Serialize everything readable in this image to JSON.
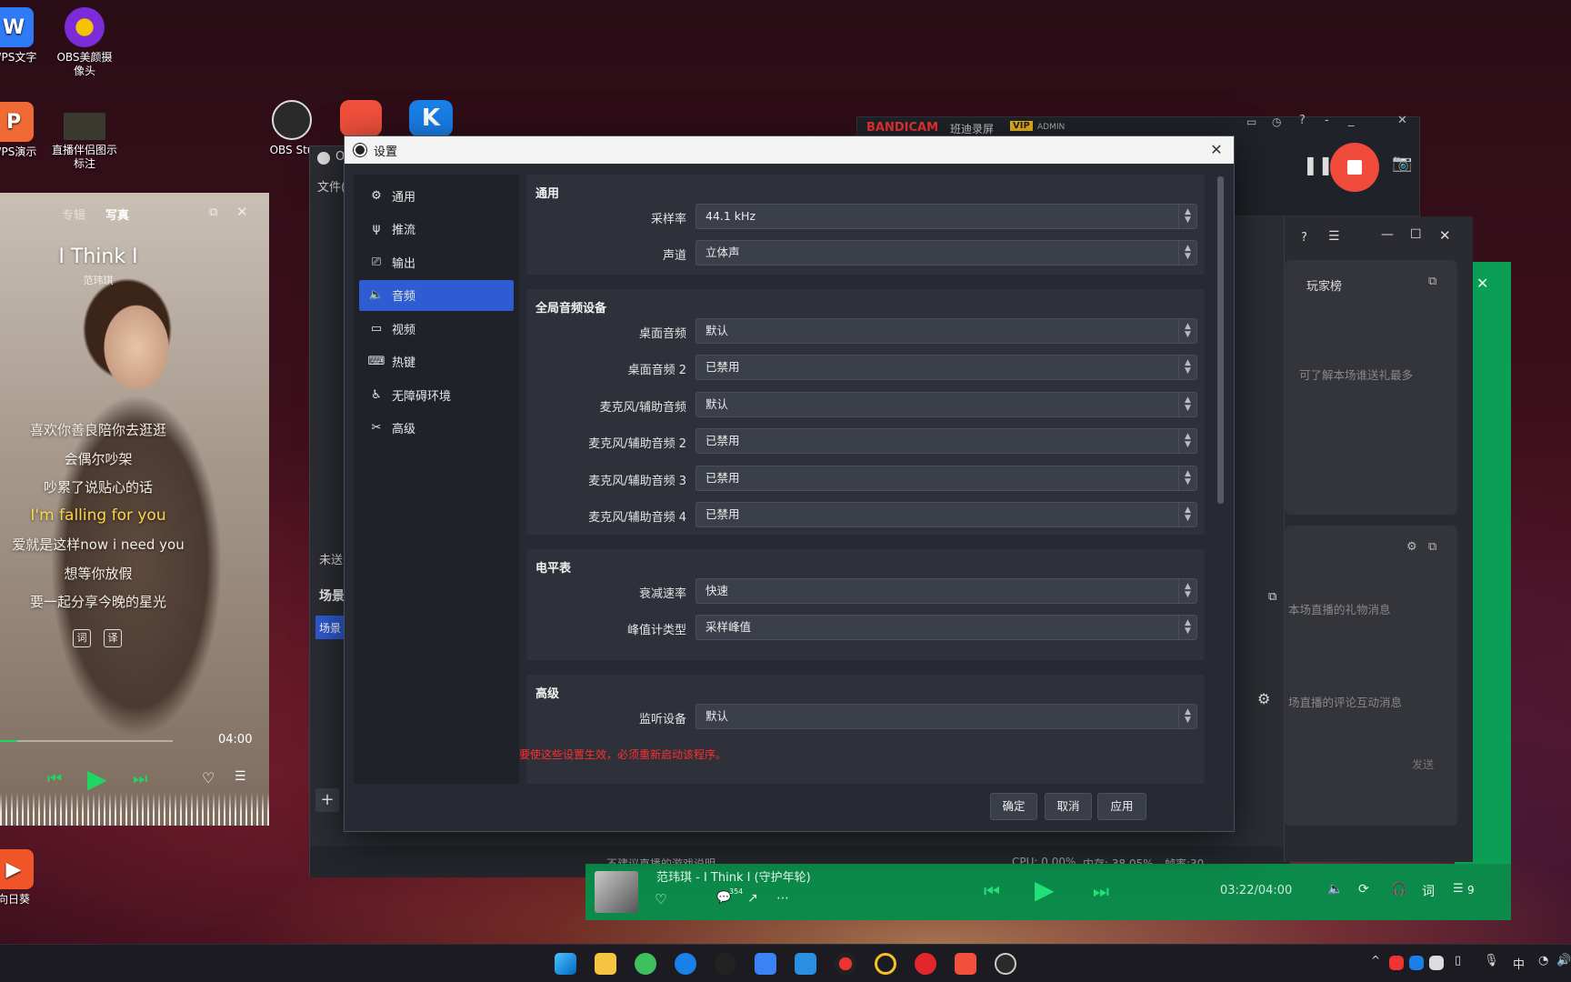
{
  "desktop": {
    "icons": [
      {
        "label": "WPS文字"
      },
      {
        "label": "OBS美颜摄\n像头"
      },
      {
        "label": "WPS演示"
      },
      {
        "label": "直播伴侣图示\n标注"
      },
      {
        "label": "OBS Stu"
      },
      {
        "label": "向日葵"
      }
    ]
  },
  "music_player": {
    "tab_album": "专辑",
    "tab_photo": "写真",
    "song_title": "I Think I",
    "artist": "范玮琪",
    "lyrics": [
      "喜欢你善良陪你去逛逛",
      "会偶尔吵架",
      "吵累了说贴心的话",
      "I'm falling for you",
      "爱就是这样now i need you",
      "想等你放假",
      "要一起分享今晚的星光"
    ],
    "highlight_lyric_index": 3,
    "duration": "04:00",
    "progress_fraction": 0.1,
    "btn_lyric": "词",
    "btn_translate": "译"
  },
  "obs_main": {
    "window_title_partial": "O",
    "menu_file": "文件(",
    "not_sent": "未送",
    "scenes_label": "场景",
    "scene_item": "场景",
    "status_game_note": "不建议直播的游戏说明",
    "status_cpu": "CPU: 0.00%",
    "status_mem": "内存: 38.05%",
    "status_fps": "帧率:30"
  },
  "bandicam": {
    "brand": "BANDICAM",
    "mode": "班迪录屏",
    "vip": "VIP",
    "admin": "ADMIN"
  },
  "chat_panel": {
    "ranking_title": "玩家榜",
    "ranking_desc": "可了解本场谁送礼最多",
    "gift_desc": "本场直播的礼物消息",
    "comment_desc": "场直播的评论互动消息",
    "send_label": "发送"
  },
  "minibar": {
    "song": "范玮琪 - I Think I (守护年轮)",
    "time": "03:22/04:00",
    "comment_count": "354",
    "lyric_btn": "词",
    "queue_count": "9"
  },
  "taskbar": {
    "ime": "中"
  },
  "settings": {
    "title": "设置",
    "sidebar": [
      {
        "label": "通用",
        "icon": "gear-icon"
      },
      {
        "label": "推流",
        "icon": "antenna-icon"
      },
      {
        "label": "输出",
        "icon": "output-icon"
      },
      {
        "label": "音频",
        "icon": "speaker-icon"
      },
      {
        "label": "视频",
        "icon": "monitor-icon"
      },
      {
        "label": "热键",
        "icon": "keyboard-icon"
      },
      {
        "label": "无障碍环境",
        "icon": "accessibility-icon"
      },
      {
        "label": "高级",
        "icon": "tools-icon"
      }
    ],
    "active_index": 3,
    "general": {
      "title": "通用",
      "sample_rate_label": "采样率",
      "sample_rate_value": "44.1 kHz",
      "channels_label": "声道",
      "channels_value": "立体声"
    },
    "global_devices": {
      "title": "全局音频设备",
      "rows": [
        {
          "label": "桌面音频",
          "value": "默认"
        },
        {
          "label": "桌面音频 2",
          "value": "已禁用"
        },
        {
          "label": "麦克风/辅助音频",
          "value": "默认"
        },
        {
          "label": "麦克风/辅助音频 2",
          "value": "已禁用"
        },
        {
          "label": "麦克风/辅助音频 3",
          "value": "已禁用"
        },
        {
          "label": "麦克风/辅助音频 4",
          "value": "已禁用"
        }
      ]
    },
    "meters": {
      "title": "电平表",
      "decay_label": "衰减速率",
      "decay_value": "快速",
      "peak_label": "峰值计类型",
      "peak_value": "采样峰值"
    },
    "advanced": {
      "title": "高级",
      "monitor_label": "监听设备",
      "monitor_value": "默认"
    },
    "restart_warning": "要使这些设置生效，必须重新启动该程序。",
    "ok": "确定",
    "cancel": "取消",
    "apply": "应用"
  }
}
